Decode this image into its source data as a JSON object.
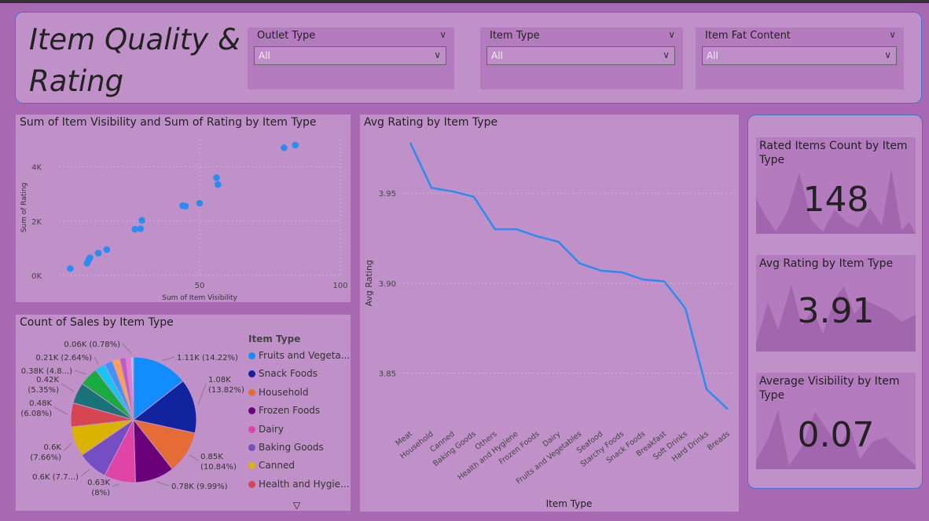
{
  "header": {
    "title": "Item Quality & Rating",
    "slicers": [
      {
        "label": "Outlet Type",
        "value": "All"
      },
      {
        "label": "Item Type",
        "value": "All"
      },
      {
        "label": "Item Fat Content",
        "value": "All"
      }
    ]
  },
  "scatter": {
    "title": "Sum of Item Visibility and Sum of Rating by Item Type",
    "chart_data": {
      "type": "scatter",
      "xlabel": "Sum of Item Visibility",
      "ylabel": "Sum of Rating",
      "xlim": [
        0,
        100
      ],
      "ylim": [
        0,
        5000
      ],
      "x_ticks": [
        {
          "v": 50,
          "label": "50"
        },
        {
          "v": 100,
          "label": "100"
        }
      ],
      "y_ticks": [
        {
          "v": 0,
          "label": "0K"
        },
        {
          "v": 2000,
          "label": "2K"
        },
        {
          "v": 4000,
          "label": "4K"
        }
      ],
      "points": [
        {
          "x": 4,
          "y": 250
        },
        {
          "x": 10,
          "y": 450
        },
        {
          "x": 10.5,
          "y": 560
        },
        {
          "x": 11,
          "y": 650
        },
        {
          "x": 14,
          "y": 820
        },
        {
          "x": 17,
          "y": 950
        },
        {
          "x": 27,
          "y": 1700
        },
        {
          "x": 29,
          "y": 1720
        },
        {
          "x": 29.5,
          "y": 2030
        },
        {
          "x": 44,
          "y": 2570
        },
        {
          "x": 45,
          "y": 2550
        },
        {
          "x": 50,
          "y": 2660
        },
        {
          "x": 56,
          "y": 3600
        },
        {
          "x": 56.5,
          "y": 3350
        },
        {
          "x": 80,
          "y": 4700
        },
        {
          "x": 84,
          "y": 4800
        }
      ]
    }
  },
  "line": {
    "title": "Avg Rating by Item Type",
    "chart_data": {
      "type": "line",
      "xlabel": "Item Type",
      "ylabel": "Avg Rating",
      "ylim": [
        3.828,
        3.978
      ],
      "y_ticks": [
        {
          "v": 3.85,
          "label": "3.85"
        },
        {
          "v": 3.9,
          "label": "3.90"
        },
        {
          "v": 3.95,
          "label": "3.95"
        }
      ],
      "categories": [
        "Meat",
        "Household",
        "Canned",
        "Baking Goods",
        "Others",
        "Health and Hygiene",
        "Frozen Foods",
        "Dairy",
        "Fruits and Vegetables",
        "Seafood",
        "Starchy Foods",
        "Snack Foods",
        "Breakfast",
        "Soft Drinks",
        "Hard Drinks",
        "Breads"
      ],
      "values": [
        3.978,
        3.953,
        3.951,
        3.948,
        3.93,
        3.93,
        3.926,
        3.923,
        3.911,
        3.907,
        3.906,
        3.902,
        3.901,
        3.886,
        3.841,
        3.83
      ],
      "color": "#2b8cf0"
    }
  },
  "pie": {
    "title": "Count of Sales by Item Type",
    "chart_data": {
      "type": "pie",
      "legend_title": "Item Type",
      "slices": [
        {
          "name": "Fruits and Vegeta...",
          "value": 14.22,
          "label": "1.11K (14.22%)",
          "color": "#118dff"
        },
        {
          "name": "Snack Foods",
          "value": 13.82,
          "label": "1.08K (13.82%)",
          "color": "#12239e"
        },
        {
          "name": "Household",
          "value": 10.84,
          "label": "0.85K (10.84%)",
          "color": "#e66c37"
        },
        {
          "name": "Frozen Foods",
          "value": 9.99,
          "label": "0.78K (9.99%)",
          "color": "#6b007b"
        },
        {
          "name": "Dairy",
          "value": 8.0,
          "label": "0.63K (8%)",
          "color": "#e044a7"
        },
        {
          "name": "Baking Goods",
          "value": 7.7,
          "label": "0.6K (7.7...)",
          "color": "#744ec2"
        },
        {
          "name": "Canned",
          "value": 7.66,
          "label": "0.6K (7.66%)",
          "color": "#d9b300"
        },
        {
          "name": "Health and Hygie...",
          "value": 6.08,
          "label": "0.48K (6.08%)",
          "color": "#d64550"
        },
        {
          "name": "",
          "value": 5.35,
          "label": "0.42K (5.35%)",
          "color": "#197278"
        },
        {
          "name": "",
          "value": 4.8,
          "label": "0.38K (4.8...)",
          "color": "#1aab40"
        },
        {
          "name": "",
          "value": 2.64,
          "label": "0.21K (2.64%)",
          "color": "#15c6f4"
        },
        {
          "name": "",
          "value": 2.1,
          "label": "",
          "color": "#4092ff"
        },
        {
          "name": "",
          "value": 2.0,
          "label": "",
          "color": "#ffa058"
        },
        {
          "name": "",
          "value": 1.5,
          "label": "",
          "color": "#be5dc9"
        },
        {
          "name": "",
          "value": 1.2,
          "label": "",
          "color": "#f472d0"
        },
        {
          "name": "",
          "value": 0.78,
          "label": "0.06K (0.78%)",
          "color": "#a9c3f5"
        }
      ]
    }
  },
  "kpis": [
    {
      "title": "Rated Items Count by Item Type",
      "value": "148"
    },
    {
      "title": "Avg Rating by Item Type",
      "value": "3.91"
    },
    {
      "title": "Average Visibility by Item Type",
      "value": "0.07"
    }
  ]
}
